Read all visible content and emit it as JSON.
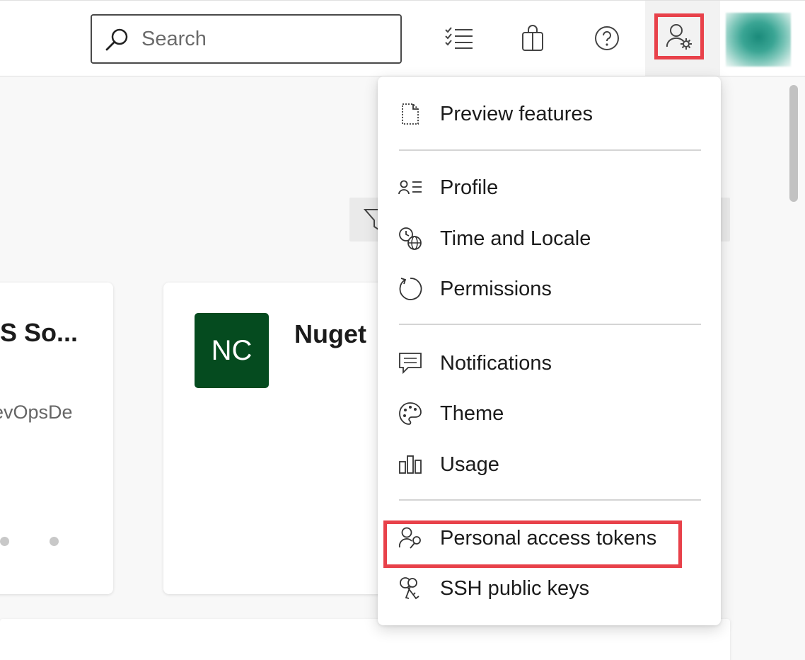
{
  "search": {
    "placeholder": "Search"
  },
  "toolbar": {
    "icons": [
      "work-items-icon",
      "marketplace-bag-icon",
      "help-icon",
      "user-settings-icon"
    ],
    "highlight_color": "#e8414a"
  },
  "cards": [
    {
      "title": "IS So...",
      "subtitle": "evOpsDe"
    },
    {
      "badge": "NC",
      "badge_color": "#054b1f",
      "title": "Nuget"
    }
  ],
  "menu": {
    "items": [
      {
        "label": "Preview features",
        "icon": "preview-page-icon"
      },
      {
        "label": "Profile",
        "icon": "profile-card-icon"
      },
      {
        "label": "Time and Locale",
        "icon": "clock-globe-icon"
      },
      {
        "label": "Permissions",
        "icon": "refresh-circle-icon"
      },
      {
        "label": "Notifications",
        "icon": "chat-bubble-icon"
      },
      {
        "label": "Theme",
        "icon": "palette-icon"
      },
      {
        "label": "Usage",
        "icon": "bar-usage-icon"
      },
      {
        "label": "Personal access tokens",
        "icon": "user-key-icon"
      },
      {
        "label": "SSH public keys",
        "icon": "keys-icon"
      }
    ]
  }
}
